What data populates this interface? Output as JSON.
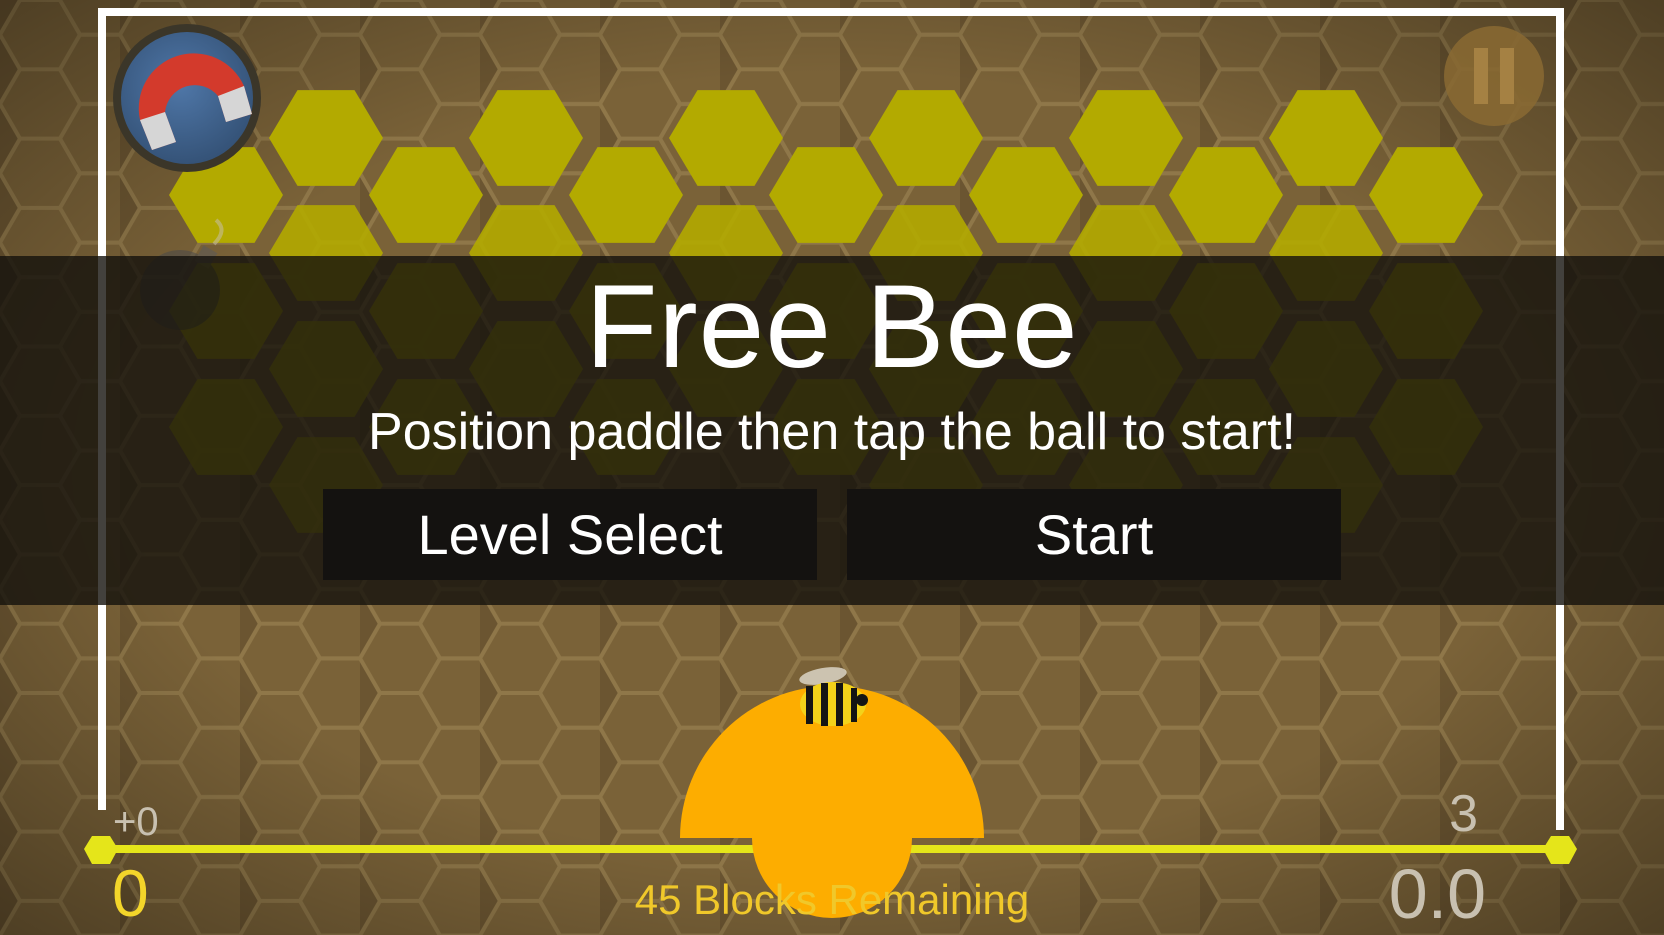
{
  "game": {
    "title": "Free Bee",
    "instruction": "Position paddle then tap the ball to start!"
  },
  "buttons": {
    "level_select": "Level Select",
    "start": "Start"
  },
  "hud": {
    "bonus": "+0",
    "lives": "3",
    "score": "0",
    "timer": "0.0",
    "blocks_remaining": "45 Blocks Remaining"
  },
  "powerups": [
    "magnet-icon",
    "bomb-icon"
  ],
  "controls": [
    "pause-icon"
  ],
  "colors": {
    "honeycomb_bg": "#6b5531",
    "block_yellow": "#b3aa00",
    "paddle": "#fdad00",
    "rail": "#e5e51a",
    "wall": "#ffffff"
  }
}
